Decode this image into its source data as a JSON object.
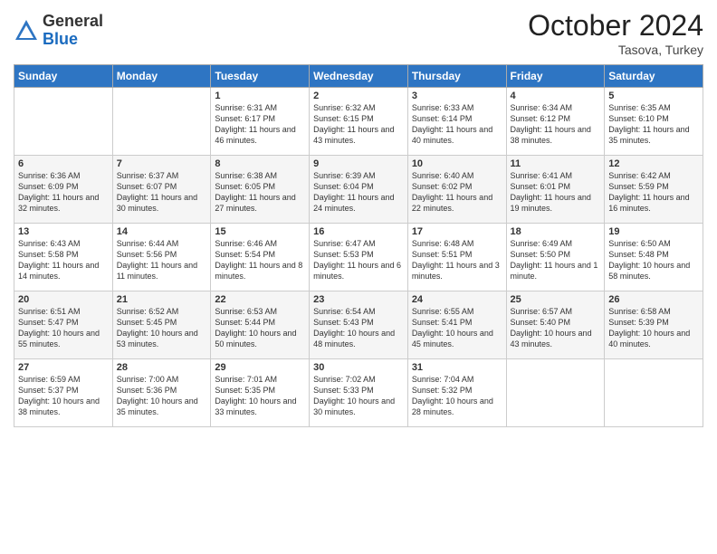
{
  "logo": {
    "general": "General",
    "blue": "Blue"
  },
  "header": {
    "month": "October 2024",
    "location": "Tasova, Turkey"
  },
  "weekdays": [
    "Sunday",
    "Monday",
    "Tuesday",
    "Wednesday",
    "Thursday",
    "Friday",
    "Saturday"
  ],
  "weeks": [
    [
      {
        "day": "",
        "sunrise": "",
        "sunset": "",
        "daylight": ""
      },
      {
        "day": "",
        "sunrise": "",
        "sunset": "",
        "daylight": ""
      },
      {
        "day": "1",
        "sunrise": "Sunrise: 6:31 AM",
        "sunset": "Sunset: 6:17 PM",
        "daylight": "Daylight: 11 hours and 46 minutes."
      },
      {
        "day": "2",
        "sunrise": "Sunrise: 6:32 AM",
        "sunset": "Sunset: 6:15 PM",
        "daylight": "Daylight: 11 hours and 43 minutes."
      },
      {
        "day": "3",
        "sunrise": "Sunrise: 6:33 AM",
        "sunset": "Sunset: 6:14 PM",
        "daylight": "Daylight: 11 hours and 40 minutes."
      },
      {
        "day": "4",
        "sunrise": "Sunrise: 6:34 AM",
        "sunset": "Sunset: 6:12 PM",
        "daylight": "Daylight: 11 hours and 38 minutes."
      },
      {
        "day": "5",
        "sunrise": "Sunrise: 6:35 AM",
        "sunset": "Sunset: 6:10 PM",
        "daylight": "Daylight: 11 hours and 35 minutes."
      }
    ],
    [
      {
        "day": "6",
        "sunrise": "Sunrise: 6:36 AM",
        "sunset": "Sunset: 6:09 PM",
        "daylight": "Daylight: 11 hours and 32 minutes."
      },
      {
        "day": "7",
        "sunrise": "Sunrise: 6:37 AM",
        "sunset": "Sunset: 6:07 PM",
        "daylight": "Daylight: 11 hours and 30 minutes."
      },
      {
        "day": "8",
        "sunrise": "Sunrise: 6:38 AM",
        "sunset": "Sunset: 6:05 PM",
        "daylight": "Daylight: 11 hours and 27 minutes."
      },
      {
        "day": "9",
        "sunrise": "Sunrise: 6:39 AM",
        "sunset": "Sunset: 6:04 PM",
        "daylight": "Daylight: 11 hours and 24 minutes."
      },
      {
        "day": "10",
        "sunrise": "Sunrise: 6:40 AM",
        "sunset": "Sunset: 6:02 PM",
        "daylight": "Daylight: 11 hours and 22 minutes."
      },
      {
        "day": "11",
        "sunrise": "Sunrise: 6:41 AM",
        "sunset": "Sunset: 6:01 PM",
        "daylight": "Daylight: 11 hours and 19 minutes."
      },
      {
        "day": "12",
        "sunrise": "Sunrise: 6:42 AM",
        "sunset": "Sunset: 5:59 PM",
        "daylight": "Daylight: 11 hours and 16 minutes."
      }
    ],
    [
      {
        "day": "13",
        "sunrise": "Sunrise: 6:43 AM",
        "sunset": "Sunset: 5:58 PM",
        "daylight": "Daylight: 11 hours and 14 minutes."
      },
      {
        "day": "14",
        "sunrise": "Sunrise: 6:44 AM",
        "sunset": "Sunset: 5:56 PM",
        "daylight": "Daylight: 11 hours and 11 minutes."
      },
      {
        "day": "15",
        "sunrise": "Sunrise: 6:46 AM",
        "sunset": "Sunset: 5:54 PM",
        "daylight": "Daylight: 11 hours and 8 minutes."
      },
      {
        "day": "16",
        "sunrise": "Sunrise: 6:47 AM",
        "sunset": "Sunset: 5:53 PM",
        "daylight": "Daylight: 11 hours and 6 minutes."
      },
      {
        "day": "17",
        "sunrise": "Sunrise: 6:48 AM",
        "sunset": "Sunset: 5:51 PM",
        "daylight": "Daylight: 11 hours and 3 minutes."
      },
      {
        "day": "18",
        "sunrise": "Sunrise: 6:49 AM",
        "sunset": "Sunset: 5:50 PM",
        "daylight": "Daylight: 11 hours and 1 minute."
      },
      {
        "day": "19",
        "sunrise": "Sunrise: 6:50 AM",
        "sunset": "Sunset: 5:48 PM",
        "daylight": "Daylight: 10 hours and 58 minutes."
      }
    ],
    [
      {
        "day": "20",
        "sunrise": "Sunrise: 6:51 AM",
        "sunset": "Sunset: 5:47 PM",
        "daylight": "Daylight: 10 hours and 55 minutes."
      },
      {
        "day": "21",
        "sunrise": "Sunrise: 6:52 AM",
        "sunset": "Sunset: 5:45 PM",
        "daylight": "Daylight: 10 hours and 53 minutes."
      },
      {
        "day": "22",
        "sunrise": "Sunrise: 6:53 AM",
        "sunset": "Sunset: 5:44 PM",
        "daylight": "Daylight: 10 hours and 50 minutes."
      },
      {
        "day": "23",
        "sunrise": "Sunrise: 6:54 AM",
        "sunset": "Sunset: 5:43 PM",
        "daylight": "Daylight: 10 hours and 48 minutes."
      },
      {
        "day": "24",
        "sunrise": "Sunrise: 6:55 AM",
        "sunset": "Sunset: 5:41 PM",
        "daylight": "Daylight: 10 hours and 45 minutes."
      },
      {
        "day": "25",
        "sunrise": "Sunrise: 6:57 AM",
        "sunset": "Sunset: 5:40 PM",
        "daylight": "Daylight: 10 hours and 43 minutes."
      },
      {
        "day": "26",
        "sunrise": "Sunrise: 6:58 AM",
        "sunset": "Sunset: 5:39 PM",
        "daylight": "Daylight: 10 hours and 40 minutes."
      }
    ],
    [
      {
        "day": "27",
        "sunrise": "Sunrise: 6:59 AM",
        "sunset": "Sunset: 5:37 PM",
        "daylight": "Daylight: 10 hours and 38 minutes."
      },
      {
        "day": "28",
        "sunrise": "Sunrise: 7:00 AM",
        "sunset": "Sunset: 5:36 PM",
        "daylight": "Daylight: 10 hours and 35 minutes."
      },
      {
        "day": "29",
        "sunrise": "Sunrise: 7:01 AM",
        "sunset": "Sunset: 5:35 PM",
        "daylight": "Daylight: 10 hours and 33 minutes."
      },
      {
        "day": "30",
        "sunrise": "Sunrise: 7:02 AM",
        "sunset": "Sunset: 5:33 PM",
        "daylight": "Daylight: 10 hours and 30 minutes."
      },
      {
        "day": "31",
        "sunrise": "Sunrise: 7:04 AM",
        "sunset": "Sunset: 5:32 PM",
        "daylight": "Daylight: 10 hours and 28 minutes."
      },
      {
        "day": "",
        "sunrise": "",
        "sunset": "",
        "daylight": ""
      },
      {
        "day": "",
        "sunrise": "",
        "sunset": "",
        "daylight": ""
      }
    ]
  ]
}
